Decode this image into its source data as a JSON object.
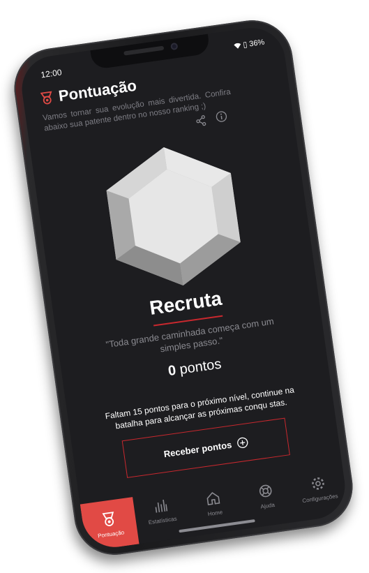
{
  "status": {
    "time": "12:00",
    "battery": "36%"
  },
  "header": {
    "title": "Pontuação"
  },
  "intro": "Vamos tornar sua evolução mais divertida. Confira abaixo sua patente dentro no nosso ranking ;)",
  "rank": {
    "name": "Recruta",
    "quote": "\"Toda grande caminhada começa com um simples passo.\"",
    "points_value": "0",
    "points_label": "pontos",
    "progress_message": "Faltam 15 pontos para o próximo nível, continue na batalha para alcançar as próximas conqu stas.",
    "button_label": "Receber pontos"
  },
  "nav": {
    "items": [
      {
        "label": "Pontuação",
        "icon": "medal-icon",
        "active": true
      },
      {
        "label": "Estatísticas",
        "icon": "bar-chart-icon"
      },
      {
        "label": "Home",
        "icon": "home-icon"
      },
      {
        "label": "Ajuda",
        "icon": "help-icon"
      },
      {
        "label": "Configurações",
        "icon": "gear-icon"
      }
    ]
  },
  "colors": {
    "accent": "#c9282e",
    "active_tab": "#e14a45",
    "background": "#1d1d20"
  }
}
